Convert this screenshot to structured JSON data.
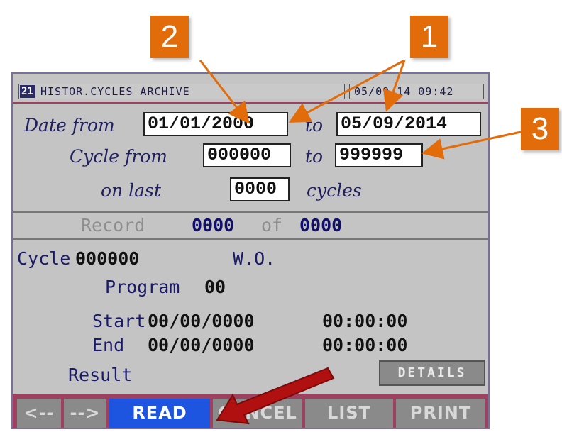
{
  "window": {
    "screen_id": "21",
    "title": "HISTOR.CYCLES ARCHIVE",
    "datetime": "05/09/14  09:42"
  },
  "filters": {
    "date_from_label": "Date from",
    "date_from_value": "01/01/2000",
    "date_to_label": "to",
    "date_to_value": "05/09/2014",
    "cycle_from_label": "Cycle from",
    "cycle_from_value": "000000",
    "cycle_to_label": "to",
    "cycle_to_value": "999999",
    "on_last_label": "on last",
    "on_last_value": "0000",
    "cycles_label": "cycles"
  },
  "record": {
    "label": "Record",
    "current": "0000",
    "of_label": "of",
    "total": "0000"
  },
  "detail": {
    "cycle_label": "Cycle",
    "cycle_value": "000000",
    "wo_label": "W.O.",
    "program_label": "Program",
    "program_value": "00",
    "start_label": "Start",
    "start_date": "00/00/0000",
    "start_time": "00:00:00",
    "end_label": "End",
    "end_date": "00/00/0000",
    "end_time": "00:00:00",
    "result_label": "Result",
    "details_button": "DETAILS"
  },
  "softkeys": [
    {
      "label": "<--"
    },
    {
      "label": "-->"
    },
    {
      "label": "READ"
    },
    {
      "label": "CANCEL"
    },
    {
      "label": "LIST"
    },
    {
      "label": "PRINT"
    }
  ],
  "callouts": [
    "2",
    "1",
    "3"
  ],
  "colors": {
    "callout": "#e36c0a",
    "arrow_highlight": "#b01010",
    "active_key": "#1e55e0",
    "screen_bg": "#c4c4c4"
  }
}
